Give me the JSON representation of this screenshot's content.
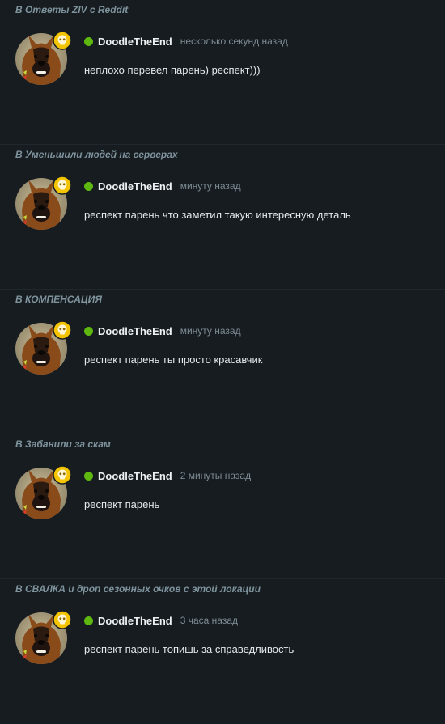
{
  "notifications": [
    {
      "header": "В Ответы ZIV с Reddit",
      "username": "DoodleTheEnd",
      "time": "несколько секунд назад",
      "message": "неплохо перевел парень) респект)))"
    },
    {
      "header": "В Уменьшили людей на серверах",
      "username": "DoodleTheEnd",
      "time": "минуту назад",
      "message": "респект парень что заметил такую интересную деталь"
    },
    {
      "header": "В КОМПЕНСАЦИЯ",
      "username": "DoodleTheEnd",
      "time": "минуту назад",
      "message": "респект парень ты просто красавчик"
    },
    {
      "header": "В Забанили за скам",
      "username": "DoodleTheEnd",
      "time": "2 минуты назад",
      "message": "респект парень"
    },
    {
      "header": "В СВАЛКА и дроп сезонных очков с этой локации",
      "username": "DoodleTheEnd",
      "time": "3 часа назад",
      "message": "респект парень топишь за справедливость"
    }
  ],
  "colors": {
    "background": "#161c20",
    "header_text": "#7f939d",
    "online_status": "#5fb80f",
    "badge": "#f5c400"
  },
  "icons": {
    "status": "online-status-dot",
    "badge": "skull-badge-icon",
    "avatar": "dog-avatar"
  }
}
